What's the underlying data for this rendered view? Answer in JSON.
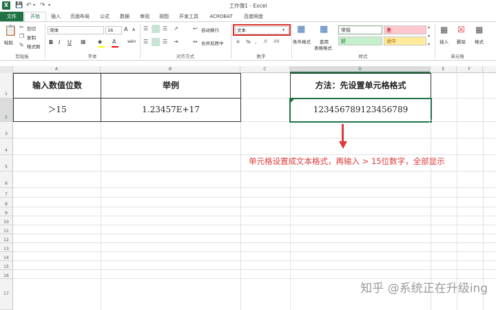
{
  "window": {
    "title": "工作簿1 - Excel"
  },
  "quick_access": {
    "save_icon": "save-icon",
    "undo_icon": "undo-icon",
    "redo_icon": "redo-icon"
  },
  "tabs": [
    {
      "label": "文件"
    },
    {
      "label": "开始"
    },
    {
      "label": "插入"
    },
    {
      "label": "页面布局"
    },
    {
      "label": "公式"
    },
    {
      "label": "数据"
    },
    {
      "label": "审阅"
    },
    {
      "label": "视图"
    },
    {
      "label": "开发工具"
    },
    {
      "label": "ACROBAT"
    },
    {
      "label": "百度网盘"
    }
  ],
  "ribbon": {
    "clipboard": {
      "paste": "粘贴",
      "cut": "剪切",
      "copy": "复制",
      "format_painter": "格式刷",
      "group": "剪贴板"
    },
    "font": {
      "name": "宋体",
      "size": "16",
      "bold": "B",
      "italic": "I",
      "underline": "U",
      "font_color": "A",
      "grow": "A",
      "shrink": "A",
      "wen": "wén",
      "group": "字体"
    },
    "alignment": {
      "wrap": "自动换行",
      "merge": "合并后居中",
      "group": "对齐方式"
    },
    "number": {
      "format": "文本",
      "percent": "%",
      "comma": ",",
      "group": "数字"
    },
    "styles": {
      "conditional": "条件格式",
      "table1": "套用",
      "table2": "表格格式",
      "normal": "常规",
      "bad": "差",
      "good": "好",
      "neutral": "适中",
      "group": "样式"
    },
    "cells": {
      "insert": "插入",
      "delete": "删除",
      "format": "格式",
      "group": "单元格"
    }
  },
  "colors": {
    "accent": "#217346",
    "annotation": "#e03a3a",
    "highlight_box": "#d9302c",
    "bad_bg": "#ffc7ce",
    "good_bg": "#c6efce",
    "neutral_bg": "#ffeb9c"
  },
  "columns": [
    "A",
    "B",
    "C",
    "D",
    "E",
    "F"
  ],
  "rows": [
    "1",
    "2",
    "3",
    "4",
    "5",
    "6",
    "7",
    "8",
    "9",
    "10",
    "11",
    "12",
    "13",
    "14",
    "15",
    "16",
    "17"
  ],
  "sheet": {
    "A1": "输入数值位数",
    "B1": "举例",
    "D1": "方法：先设置单元格格式",
    "A2": "＞15",
    "B2": "1.23457E+17",
    "D2": "123456789123456789"
  },
  "annotation": "单元格设置成文本格式，再输入 > 15位数字，全部显示",
  "watermark": "知乎 @系统正在升级ing"
}
